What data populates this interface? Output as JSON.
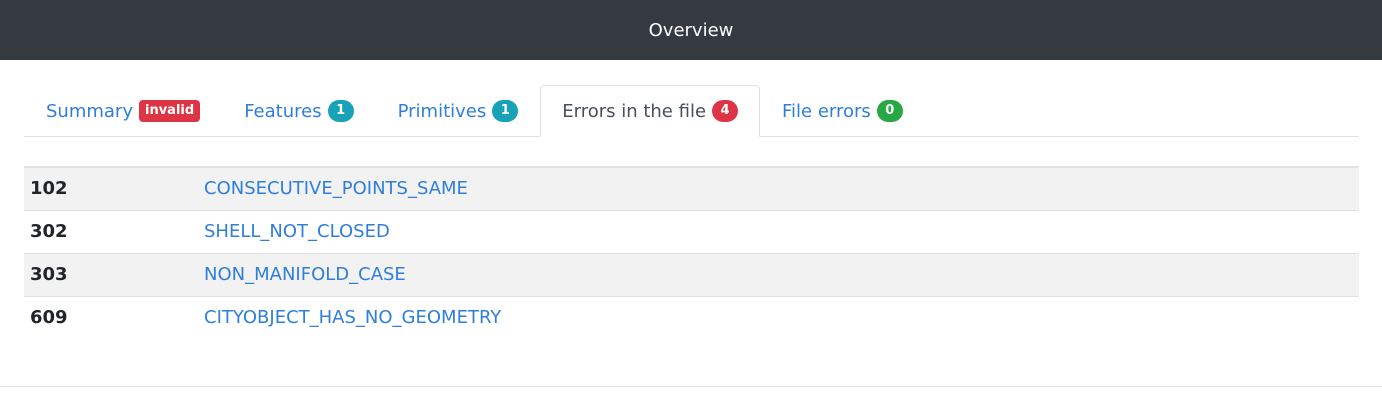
{
  "header": {
    "title": "Overview"
  },
  "tabs": [
    {
      "label": "Summary",
      "badge": "invalid"
    },
    {
      "label": "Features",
      "badge": "1"
    },
    {
      "label": "Primitives",
      "badge": "1"
    },
    {
      "label": "Errors in the file",
      "badge": "4"
    },
    {
      "label": "File errors",
      "badge": "0"
    }
  ],
  "colors": {
    "header_bg": "#343a40",
    "link": "#2f7fd8",
    "badge_red": "#dc3545",
    "badge_teal": "#17a2b8",
    "badge_green": "#28a745"
  },
  "errors": [
    {
      "code": "102",
      "name": "CONSECUTIVE_POINTS_SAME"
    },
    {
      "code": "302",
      "name": "SHELL_NOT_CLOSED"
    },
    {
      "code": "303",
      "name": "NON_MANIFOLD_CASE"
    },
    {
      "code": "609",
      "name": "CITYOBJECT_HAS_NO_GEOMETRY"
    }
  ]
}
